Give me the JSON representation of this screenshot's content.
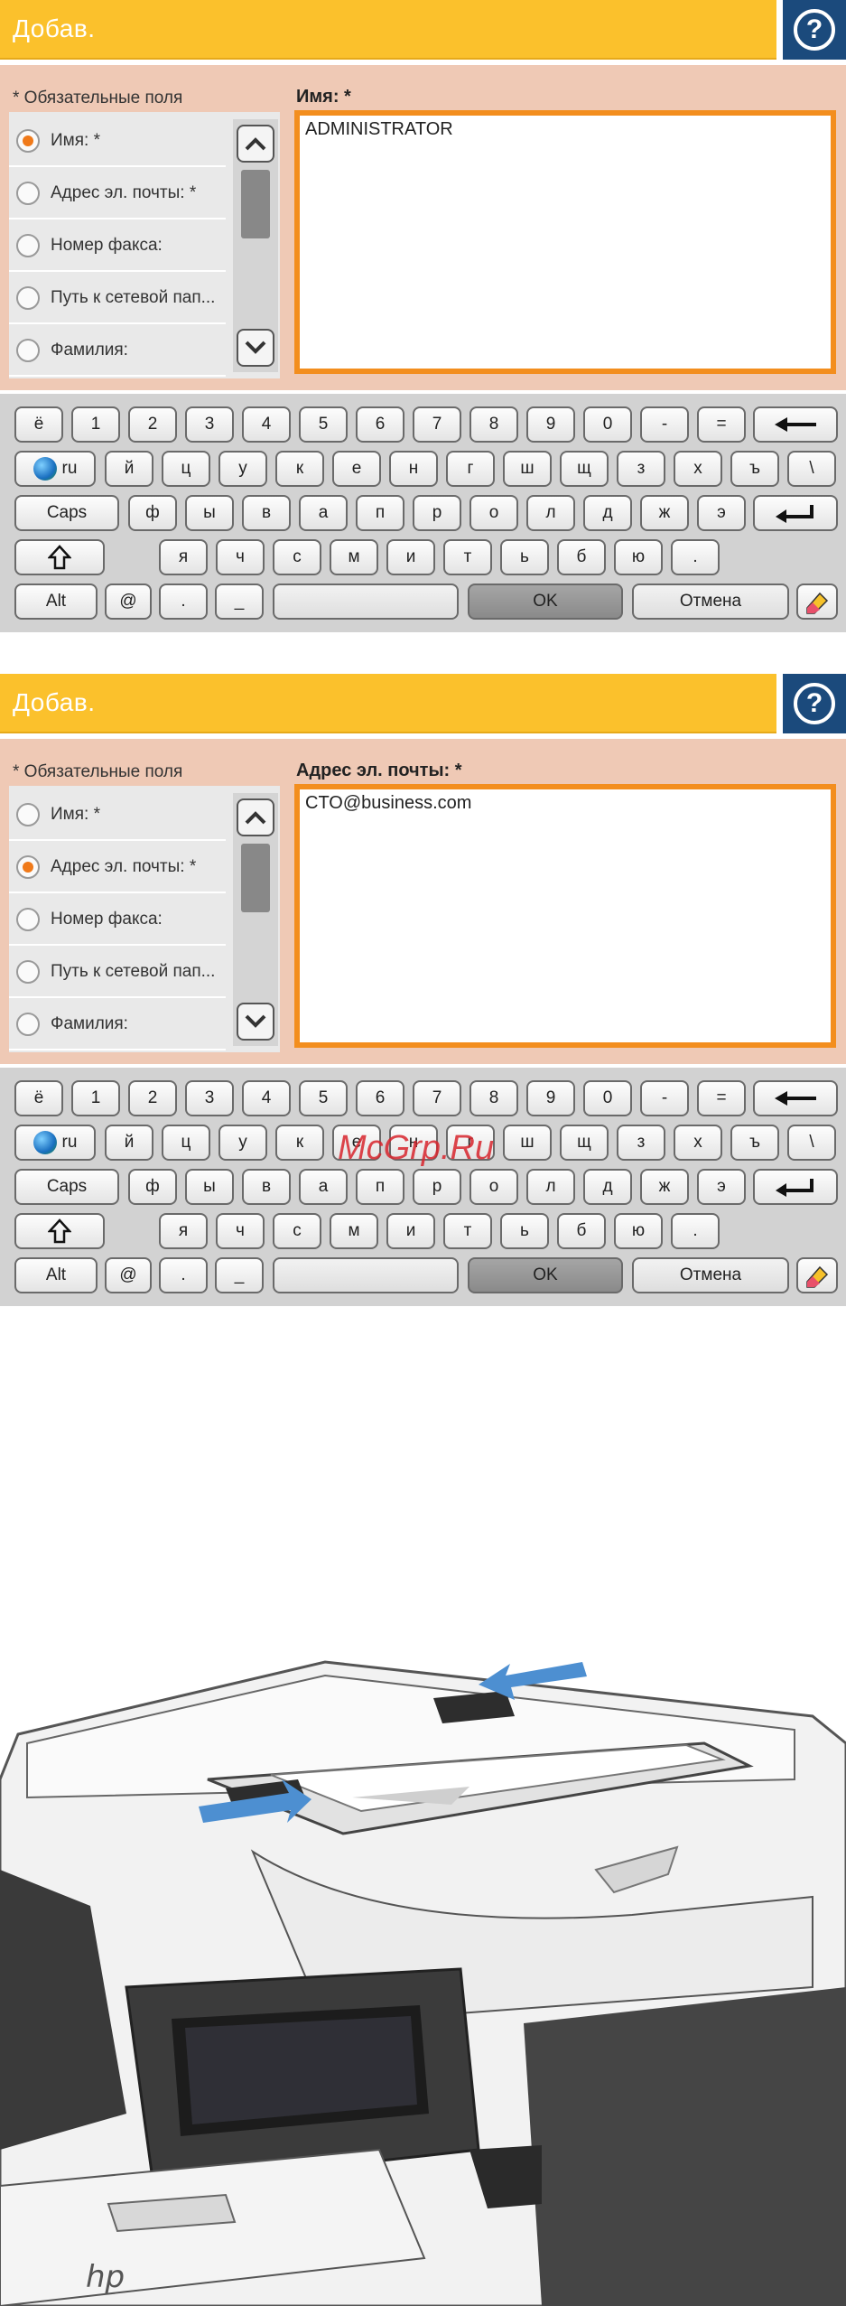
{
  "screens": [
    {
      "title": "Добав.",
      "required_note": "* Обязательные поля",
      "field_label": "Имя: *",
      "field_value": "ADMINISTRATOR",
      "selected_index": 0
    },
    {
      "title": "Добав.",
      "required_note": "* Обязательные поля",
      "field_label": "Адрес эл. почты: *",
      "field_value": "CTO@business.com",
      "selected_index": 1
    }
  ],
  "fields": [
    {
      "label": "Имя: *"
    },
    {
      "label": "Адрес эл. почты: *"
    },
    {
      "label": "Номер факса:"
    },
    {
      "label": "Путь к сетевой пап..."
    },
    {
      "label": "Фамилия:"
    }
  ],
  "keyboard": {
    "row1": [
      "ё",
      "1",
      "2",
      "3",
      "4",
      "5",
      "6",
      "7",
      "8",
      "9",
      "0",
      "-",
      "="
    ],
    "row2": [
      "й",
      "ц",
      "у",
      "к",
      "е",
      "н",
      "г",
      "ш",
      "щ",
      "з",
      "х",
      "ъ",
      "\\"
    ],
    "row3": [
      "ф",
      "ы",
      "в",
      "а",
      "п",
      "р",
      "о",
      "л",
      "д",
      "ж",
      "э"
    ],
    "row4": [
      "я",
      "ч",
      "с",
      "м",
      "и",
      "т",
      "ь",
      "б",
      "ю",
      "."
    ],
    "lang_label": "ru",
    "caps_label": "Caps",
    "alt_label": "Alt",
    "at_label": "@",
    "dot_label": ".",
    "underscore_label": "_",
    "ok_label": "OK",
    "cancel_label": "Отмена"
  },
  "watermark": "McGrp.Ru",
  "colors": {
    "titlebar": "#fbc12c",
    "help": "#1b4a7c",
    "form_bg": "#efc9b5",
    "input_border": "#f38e1e",
    "radio_selected": "#f07a1a"
  }
}
